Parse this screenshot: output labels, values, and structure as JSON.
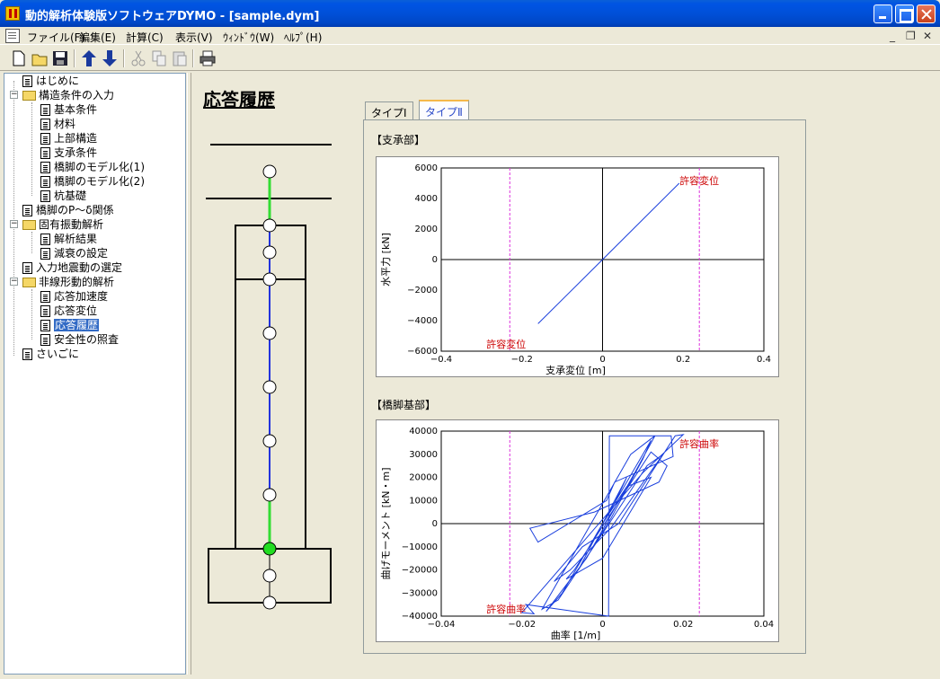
{
  "window": {
    "title": "動的解析体験版ソフトウェアDYMO - [sample.dym]"
  },
  "menu": {
    "items": [
      {
        "label": "ファイル(F)"
      },
      {
        "label": "編集(E)"
      },
      {
        "label": "計算(C)"
      },
      {
        "label": "表示(V)"
      },
      {
        "label": "ｳｨﾝﾄﾞｳ(W)"
      },
      {
        "label": "ﾍﾙﾌﾟ(H)"
      }
    ]
  },
  "toolbar": {
    "buttons": [
      "new-icon",
      "open-icon",
      "save-icon",
      "up-arrow-icon",
      "down-arrow-icon",
      "cut-icon",
      "copy-icon",
      "paste-icon",
      "print-icon"
    ]
  },
  "tree": {
    "items": [
      {
        "label": "はじめに"
      },
      {
        "label": "構造条件の入力"
      },
      {
        "label": "基本条件"
      },
      {
        "label": "材料"
      },
      {
        "label": "上部構造"
      },
      {
        "label": "支承条件"
      },
      {
        "label": "橋脚のモデル化(1)"
      },
      {
        "label": "橋脚のモデル化(2)"
      },
      {
        "label": "杭基礎"
      },
      {
        "label": "橋脚のP～δ関係"
      },
      {
        "label": "固有振動解析"
      },
      {
        "label": "解析結果"
      },
      {
        "label": "減衰の設定"
      },
      {
        "label": "入力地震動の選定"
      },
      {
        "label": "非線形動的解析"
      },
      {
        "label": "応答加速度"
      },
      {
        "label": "応答変位"
      },
      {
        "label": "応答履歴"
      },
      {
        "label": "安全性の照査"
      },
      {
        "label": "さいごに"
      }
    ]
  },
  "content": {
    "title": "応答履歴",
    "tabs": [
      {
        "label": "タイプⅠ",
        "active": false
      },
      {
        "label": "タイプⅡ",
        "active": true
      }
    ]
  },
  "colors": {
    "node_active": "#22dd22",
    "member_top": "#33dd33",
    "member_main": "#2233dd",
    "allowable_line": "#dd33dd",
    "allowable_text": "#cc0000",
    "curve": "#1a3fdd"
  },
  "chart_data": [
    {
      "type": "line",
      "section": "【支承部】",
      "xlabel": "支承変位 [m]",
      "ylabel": "水平力 [kN]",
      "xlim": [
        -0.4,
        0.4
      ],
      "ylim": [
        -6000,
        6000
      ],
      "xticks": [
        "−0.4",
        "−0.2",
        "0",
        "0.2",
        "0.4"
      ],
      "yticks": [
        "6000",
        "4000",
        "2000",
        "0",
        "−2000",
        "−4000",
        "−6000"
      ],
      "allowable_x": [
        -0.23,
        0.24
      ],
      "annotations": [
        "許容変位",
        "許容変位"
      ],
      "series": [
        {
          "x": [
            -0.16,
            0.0,
            0.19
          ],
          "y": [
            -4200,
            0,
            5000
          ]
        }
      ]
    },
    {
      "type": "line",
      "section": "【橋脚基部】",
      "xlabel": "曲率 [1/m]",
      "ylabel": "曲げモーメント [kN・m]",
      "xlim": [
        -0.04,
        0.04
      ],
      "ylim": [
        -40000,
        40000
      ],
      "xticks": [
        "−0.04",
        "−0.02",
        "0",
        "0.02",
        "0.04"
      ],
      "yticks": [
        "40000",
        "30000",
        "20000",
        "10000",
        "0",
        "−10000",
        "−20000",
        "−30000",
        "−40000"
      ],
      "allowable_x": [
        -0.023,
        0.024
      ],
      "annotations": [
        "許容曲率",
        "許容曲率"
      ],
      "series": [
        {
          "x": [
            0,
            0.003,
            0.006,
            -0.006,
            -0.003,
            0.002,
            0.01,
            0.012,
            -0.01,
            -0.014,
            -0.004,
            0.008,
            0.013,
            0.007,
            -0.015,
            -0.011,
            0.002,
            0.011,
            0.015,
            0.002,
            -0.008,
            -0.012,
            -0.005,
            0.004,
            0.018,
            0.02,
            0.01,
            -0.02,
            -0.017,
            -0.019,
            0.0015,
            0.0017,
            0.017,
            0.0175,
            0.003,
            0.001,
            -0.016,
            -0.018,
            -0.002,
            0.014,
            0.016,
            0.012,
            -0.007,
            -0.009,
            0.0,
            0.012,
            0.006,
            0.0
          ],
          "y": [
            0,
            9000,
            20000,
            -20000,
            -12000,
            2000,
            28000,
            36000,
            -30000,
            -38000,
            -15000,
            22000,
            38000,
            30000,
            -37000,
            -33000,
            1000,
            25000,
            30000,
            -2000,
            -20000,
            -25000,
            -10000,
            0,
            38000,
            38500,
            22000,
            -38500,
            -39000,
            -35000,
            -40000,
            38000,
            38000,
            29000,
            18000,
            10000,
            -8000,
            -2000,
            5000,
            18000,
            25000,
            31000,
            -20000,
            -24000,
            -15000,
            20000,
            16000,
            0
          ]
        }
      ]
    }
  ]
}
